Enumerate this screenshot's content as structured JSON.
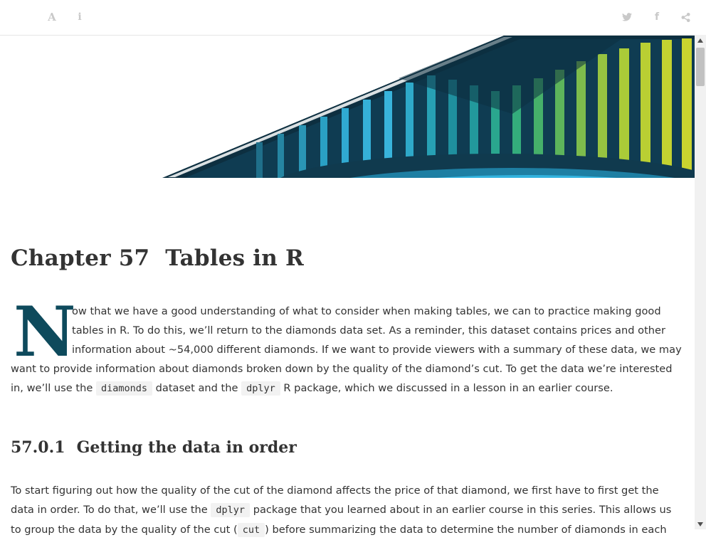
{
  "toolbar": {
    "left_icons": [
      {
        "name": "font-settings-icon",
        "glyph": "A"
      },
      {
        "name": "info-icon",
        "glyph": "i"
      }
    ],
    "right_icons": [
      {
        "name": "twitter-icon"
      },
      {
        "name": "facebook-icon",
        "glyph": "f"
      },
      {
        "name": "share-icon"
      }
    ],
    "icon_color": "#c9c9c9"
  },
  "banner": {
    "colors": {
      "dark": "#0b3a4f",
      "navy": "#0d2f40",
      "cyan": "#35b0d8",
      "teal": "#1f8f9e",
      "green": "#46b06a",
      "lime": "#c3d231"
    }
  },
  "chapter": {
    "number": "Chapter 57",
    "title": "Tables in R"
  },
  "intro": {
    "dropcap": "N",
    "text_1": "ow that we have a good understanding of what to consider when making tables, we can to practice making good tables in R. To do this, we’ll return to the diamonds data set. As a reminder, this dataset contains prices and other information about ~54,000 different diamonds. If we want to provide viewers with a summary of these data, we may want to provide information about diamonds broken down by the quality of the diamond’s cut. To get the data we’re interested in, we’ll use the ",
    "code_1": "diamonds",
    "text_2": " dataset and the ",
    "code_2": "dplyr",
    "text_3": " R package, which we discussed in a lesson in an earlier course."
  },
  "section": {
    "number": "57.0.1",
    "title": "Getting the data in order",
    "text_1": "To start figuring out how the quality of the cut of the diamond affects the price of that diamond, we first have to first get the data in order. To do that, we’ll use the ",
    "code_1": "dplyr",
    "text_2": " package that you learned about in an earlier course in this series. This allows us to group the data by the quality of the cut (",
    "code_2": "cut",
    "text_3": ") before summarizing the data to determine the number of diamonds in each"
  },
  "colors": {
    "dropcap": "#0e4a5c",
    "text": "#333333",
    "code_bg": "#f2f2f2"
  }
}
